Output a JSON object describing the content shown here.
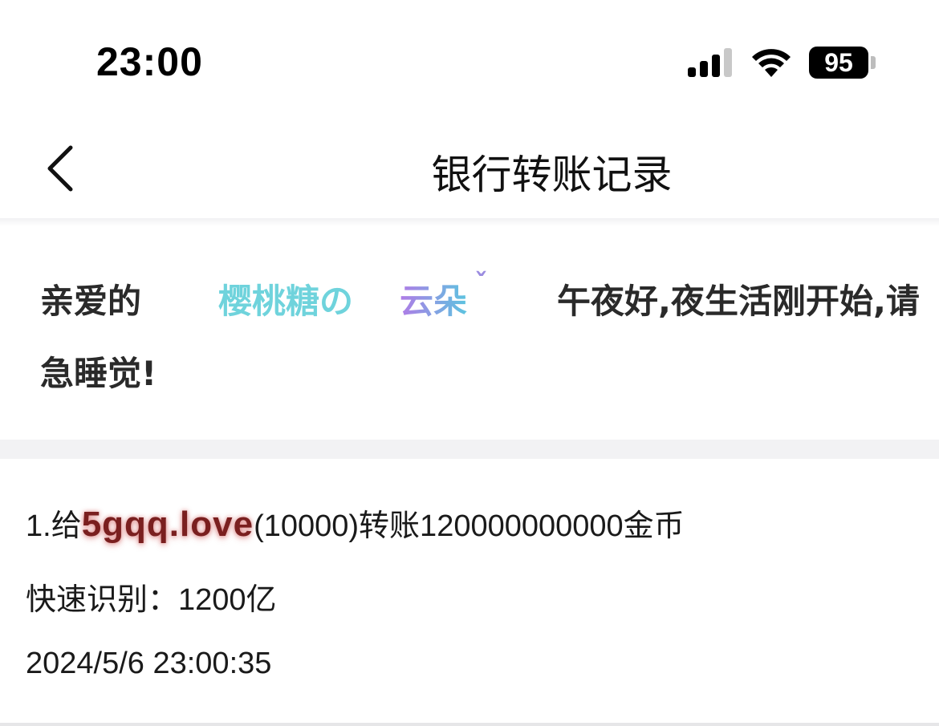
{
  "status_bar": {
    "time": "23:00",
    "battery": "95",
    "icons": [
      "signal-icon",
      "wifi-icon",
      "battery-icon"
    ]
  },
  "nav": {
    "title": "银行转账记录",
    "back_icon": "chevron-left-icon"
  },
  "greeting": {
    "prefix": "亲爱的",
    "name_part1": "樱桃糖の",
    "name_part2": "云朵",
    "name_mark": "ˇ",
    "message": "午夜好,夜生活刚开始,请",
    "message_cont": "急睡觉!",
    "colors": {
      "name_part1": "#6fd3dc",
      "name_part2_from": "#b07be6",
      "name_part2_to": "#5cc4e0"
    }
  },
  "record": {
    "line1_prefix": "1.给",
    "user": "5gqq.love",
    "line1_suffix": "(10000)转账120000000000金币",
    "line2": "快速识别：1200亿",
    "line3": "2024/5/6 23:00:35",
    "colors": {
      "user": "#7a1f1f"
    }
  }
}
